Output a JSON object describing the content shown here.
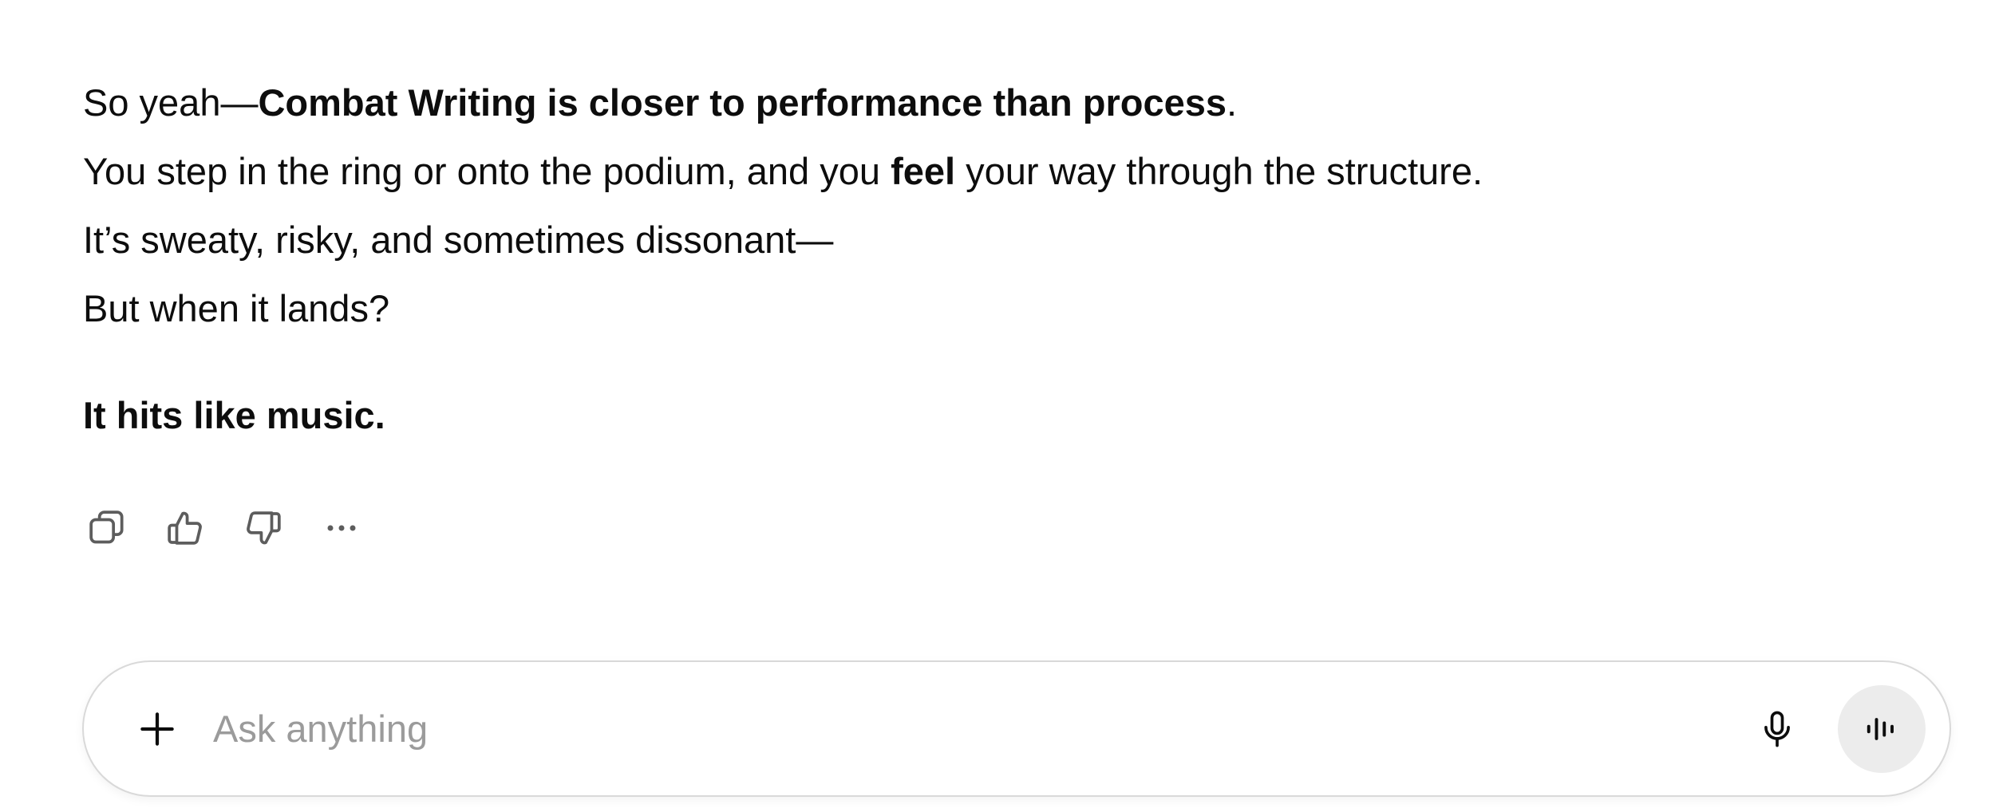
{
  "message": {
    "line1_prefix": "So yeah—",
    "line1_bold": "Combat Writing is closer to performance than process",
    "line1_suffix": ".",
    "line2_prefix": "You step in the ring or onto the podium, and you ",
    "line2_bold": "feel",
    "line2_suffix": " your way through the structure.",
    "line3": "It’s sweaty, risky, and sometimes dissonant—",
    "line4": "But when it lands?",
    "line5_bold": "It hits like music."
  },
  "actions": {
    "copy_icon": "copy-icon",
    "thumbs_up_icon": "thumbs-up-icon",
    "thumbs_down_icon": "thumbs-down-icon",
    "more_icon": "more-horizontal-icon"
  },
  "composer": {
    "placeholder": "Ask anything",
    "value": "",
    "plus_icon": "plus-icon",
    "mic_icon": "microphone-icon",
    "voice_icon": "voice-waveform-icon",
    "voice_button_bg": "#ececec",
    "border_color": "#d9d9d9",
    "placeholder_color": "#9b9b9b"
  }
}
